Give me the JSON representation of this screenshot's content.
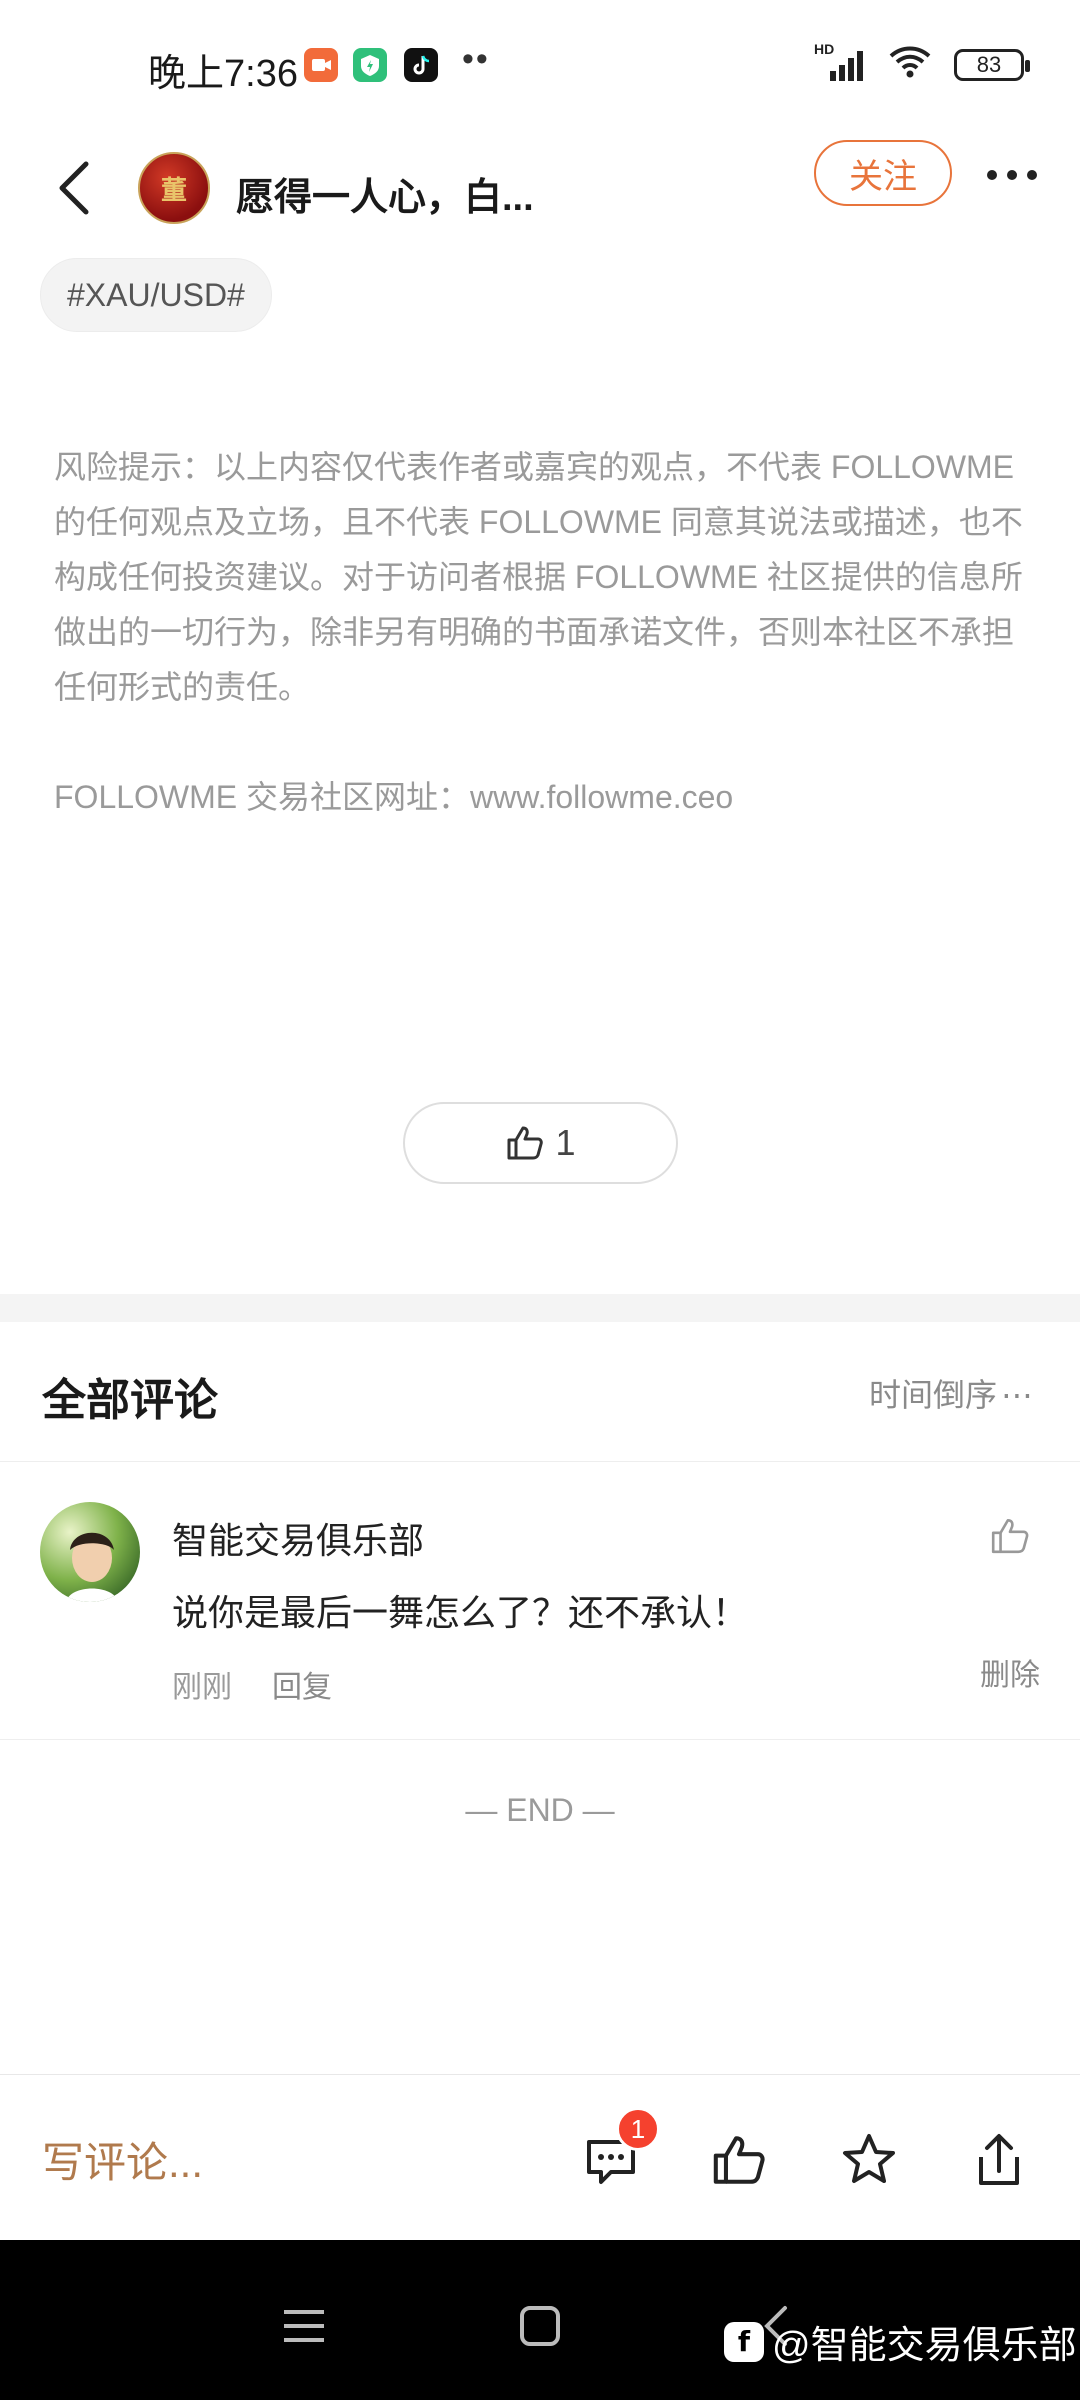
{
  "status_bar": {
    "time": "晚上7:36",
    "battery": "83",
    "signal_label": "HD",
    "icons": [
      "video-app-icon",
      "shield-app-icon",
      "tiktok-app-icon",
      "more-dots-icon",
      "signal-icon",
      "wifi-icon",
      "battery-icon"
    ]
  },
  "header": {
    "title": "愿得一人心，白...",
    "avatar_text": "董",
    "follow_label": "关注"
  },
  "tag": "#XAU/USD#",
  "disclaimer": {
    "text": "风险提示：以上内容仅代表作者或嘉宾的观点，不代表 FOLLOWME 的任何观点及立场，且不代表 FOLLOWME 同意其说法或描述，也不构成任何投资建议。对于访问者根据 FOLLOWME 社区提供的信息所做出的一切行为，除非另有明确的书面承诺文件，否则本社区不承担任何形式的责任。",
    "site": "FOLLOWME 交易社区网址：www.followme.ceo"
  },
  "like": {
    "count": "1"
  },
  "comments": {
    "title": "全部评论",
    "sort_label": "时间倒序",
    "items": [
      {
        "author": "智能交易俱乐部",
        "text": "说你是最后一舞怎么了？还不承认！",
        "time": "刚刚",
        "reply_label": "回复",
        "delete_label": "删除"
      }
    ],
    "end_label": "— END —"
  },
  "action_bar": {
    "write_placeholder": "写评论...",
    "comment_badge": "1"
  },
  "nav_bar": {
    "watermark": "@智能交易俱乐部",
    "watermark_logo": "f"
  },
  "colors": {
    "accent": "#e8743b",
    "write_comment": "#b07a4d",
    "badge": "#f5412e"
  }
}
